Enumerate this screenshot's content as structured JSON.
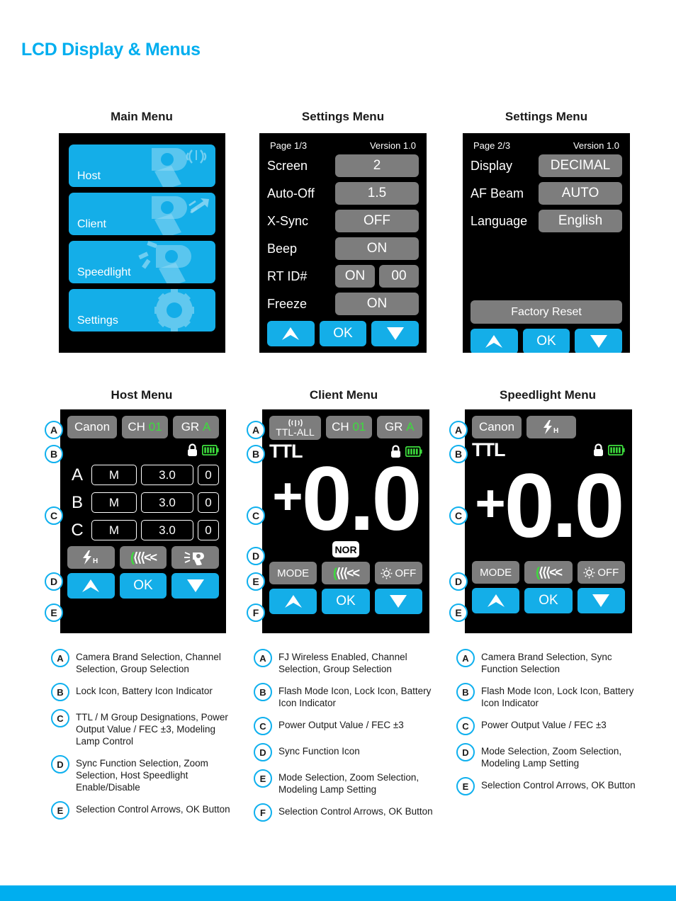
{
  "page": {
    "title": "LCD Display & Menus",
    "accent": "#00aeef",
    "lcd_bg": "#000000",
    "chip_gray": "#7d7d7d",
    "green": "#3ddc3d"
  },
  "main_menu": {
    "heading": "Main Menu",
    "items": [
      {
        "label": "Host",
        "icon": "flash-wireless-icon"
      },
      {
        "label": "Client",
        "icon": "flash-receive-icon"
      },
      {
        "label": "Speedlight",
        "icon": "flash-fire-icon"
      },
      {
        "label": "Settings",
        "icon": "gear-icon"
      }
    ]
  },
  "settings1": {
    "heading": "Settings Menu",
    "page": "Page 1/3",
    "version": "Version  1.0",
    "rows": [
      {
        "label": "Screen",
        "value": "2"
      },
      {
        "label": "Auto-Off",
        "value": "1.5"
      },
      {
        "label": "X-Sync",
        "value": "OFF"
      },
      {
        "label": "Beep",
        "value": "ON"
      },
      {
        "label": "RT ID#",
        "value": "ON",
        "value2": "00"
      },
      {
        "label": "Freeze",
        "value": "ON"
      }
    ],
    "nav": {
      "up": "up-arrow-icon",
      "ok": "OK",
      "down": "down-arrow-icon"
    }
  },
  "settings2": {
    "heading": "Settings Menu",
    "page": "Page 2/3",
    "version": "Version  1.0",
    "rows": [
      {
        "label": "Display",
        "value": "DECIMAL"
      },
      {
        "label": "AF Beam",
        "value": "AUTO"
      },
      {
        "label": "Language",
        "value": "English"
      }
    ],
    "factory_reset": "Factory Reset",
    "nav": {
      "up": "up-arrow-icon",
      "ok": "OK",
      "down": "down-arrow-icon"
    }
  },
  "host_menu": {
    "heading": "Host Menu",
    "brand": "Canon",
    "channel_label": "CH",
    "channel_value": "01",
    "group_label": "GR",
    "group_value": "A",
    "lock_icon": "lock-icon",
    "battery_icon": "battery-full-icon",
    "groups": [
      {
        "name": "A",
        "mode": "M",
        "power": "3.0",
        "zoom": "0"
      },
      {
        "name": "B",
        "mode": "M",
        "power": "3.0",
        "zoom": "0"
      },
      {
        "name": "C",
        "mode": "M",
        "power": "3.0",
        "zoom": "0"
      }
    ],
    "actions": {
      "sync": "hss-flash-icon",
      "zoom": "<<<<<",
      "speedlight": "host-speedlight-icon"
    },
    "nav": {
      "up": "up-arrow-icon",
      "ok": "OK",
      "down": "down-arrow-icon"
    },
    "markers": [
      "A",
      "B",
      "C",
      "D",
      "E"
    ]
  },
  "client_menu": {
    "heading": "Client Menu",
    "wireless_icon": "antenna-icon",
    "wireless_label": "TTL-ALL",
    "channel_label": "CH",
    "channel_value": "01",
    "group_label": "GR",
    "group_value": "A",
    "flash_mode": "TTL",
    "lock_icon": "lock-icon",
    "battery_icon": "battery-full-icon",
    "fec_sign": "+",
    "fec_value": "0.0",
    "sync_badge": "NOR",
    "actions": {
      "mode": "MODE",
      "zoom": "<<<<<",
      "lamp": "OFF",
      "lamp_icon": "modeling-lamp-icon"
    },
    "nav": {
      "up": "up-arrow-icon",
      "ok": "OK",
      "down": "down-arrow-icon"
    },
    "markers": [
      "A",
      "B",
      "C",
      "D",
      "E",
      "F"
    ]
  },
  "speedlight_menu": {
    "heading": "Speedlight Menu",
    "brand": "Canon",
    "sync_icon": "hss-flash-icon",
    "flash_mode": "TTL",
    "lock_icon": "lock-icon",
    "battery_icon": "battery-full-icon",
    "fec_sign": "+",
    "fec_value": "0.0",
    "actions": {
      "mode": "MODE",
      "zoom": "<<<<<",
      "lamp": "OFF",
      "lamp_icon": "modeling-lamp-icon"
    },
    "nav": {
      "up": "up-arrow-icon",
      "ok": "OK",
      "down": "down-arrow-icon"
    },
    "markers": [
      "A",
      "B",
      "C",
      "D",
      "E"
    ]
  },
  "legend_host": [
    {
      "key": "A",
      "text": "Camera Brand Selection, Channel Selection, Group Selection"
    },
    {
      "key": "B",
      "text": "Lock Icon, Battery Icon Indicator"
    },
    {
      "key": "C",
      "text": "TTL / M Group Designations, Power Output Value / FEC ±3, Modeling Lamp Control"
    },
    {
      "key": "D",
      "text": "Sync Function Selection, Zoom Selection, Host Speedlight Enable/Disable"
    },
    {
      "key": "E",
      "text": "Selection Control Arrows, OK Button"
    }
  ],
  "legend_client": [
    {
      "key": "A",
      "text": "FJ Wireless Enabled, Channel Selection, Group Selection"
    },
    {
      "key": "B",
      "text": "Flash Mode Icon, Lock Icon, Battery Icon Indicator"
    },
    {
      "key": "C",
      "text": "Power Output Value / FEC ±3"
    },
    {
      "key": "D",
      "text": "Sync Function Icon"
    },
    {
      "key": "E",
      "text": "Mode Selection, Zoom Selection, Modeling Lamp Setting"
    },
    {
      "key": "F",
      "text": "Selection Control Arrows, OK Button"
    }
  ],
  "legend_speedlight": [
    {
      "key": "A",
      "text": "Camera Brand Selection, Sync Function Selection"
    },
    {
      "key": "B",
      "text": "Flash Mode Icon, Lock Icon, Battery Icon Indicator"
    },
    {
      "key": "C",
      "text": "Power Output Value / FEC ±3"
    },
    {
      "key": "D",
      "text": "Mode Selection, Zoom Selection, Modeling Lamp Setting"
    },
    {
      "key": "E",
      "text": "Selection Control Arrows, OK Button"
    }
  ]
}
